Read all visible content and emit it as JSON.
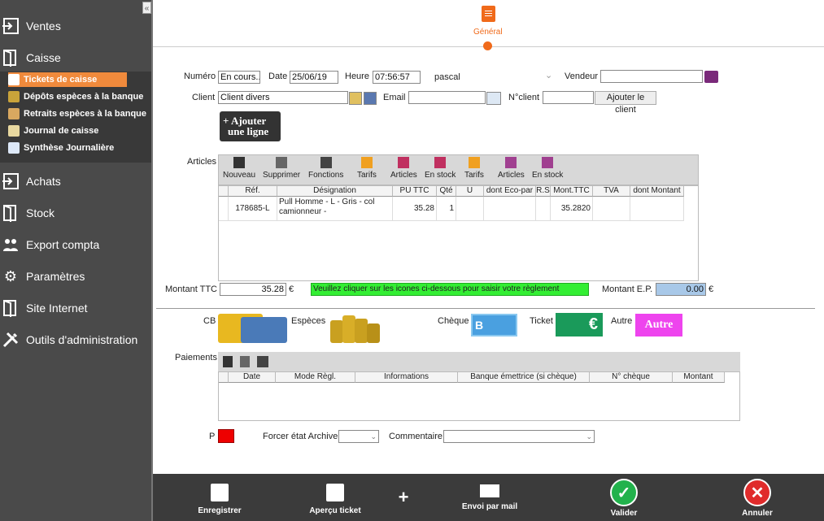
{
  "sidebar": {
    "collapse": "«",
    "items": [
      {
        "label": "Ventes",
        "icon": "enter-icon"
      },
      {
        "label": "Caisse",
        "icon": "door-icon"
      },
      {
        "label": "Achats",
        "icon": "enter-icon"
      },
      {
        "label": "Stock",
        "icon": "door-icon"
      },
      {
        "label": "Export compta",
        "icon": "people-icon"
      },
      {
        "label": "Paramètres",
        "icon": "gear-icon"
      },
      {
        "label": "Site Internet",
        "icon": "door-icon"
      },
      {
        "label": "Outils d'administration",
        "icon": "tools-icon"
      }
    ],
    "sub_items": [
      {
        "label": "Tickets de caisse"
      },
      {
        "label": "Dépôts espèces à la banque"
      },
      {
        "label": "Retraits espèces à la banque"
      },
      {
        "label": "Journal de caisse"
      },
      {
        "label": "Synthèse Journalière"
      }
    ]
  },
  "tab": {
    "label": "Général"
  },
  "form": {
    "numero_label": "Numéro",
    "numero": "En cours...",
    "date_label": "Date",
    "date": "25/06/19",
    "heure_label": "Heure",
    "heure": "07:56:57",
    "user": "pascal",
    "vendeur_label": "Vendeur",
    "vendeur": "",
    "client_label": "Client",
    "client": "Client divers",
    "email_label": "Email",
    "email": "",
    "nclient_label": "N°client",
    "nclient": "",
    "add_client": "Ajouter le client",
    "add_line_1": "+ Ajouter",
    "add_line_2": "une ligne"
  },
  "articles": {
    "label": "Articles",
    "toolbar": [
      "Nouveau",
      "Supprimer",
      "Fonctions",
      "Tarifs",
      "Articles",
      "En stock",
      "Tarifs",
      "Articles",
      "En stock"
    ],
    "columns": [
      "Réf.",
      "Désignation",
      "PU TTC",
      "Qté",
      "U",
      "dont Eco-par",
      "R.S",
      "Mont.TTC",
      "TVA",
      "dont Montant"
    ],
    "rows": [
      {
        "ref": "178685-L",
        "designation": "Pull Homme - L - Gris - col camionneur -",
        "pu": "35.28",
        "qte": "1",
        "u": "",
        "eco": "",
        "rs": "",
        "mont": "35.2820",
        "tva": "",
        "dont": ""
      }
    ]
  },
  "totals": {
    "montant_ttc_label": "Montant TTC",
    "montant_ttc": "35.28",
    "currency": "€",
    "message": "Veuillez cliquer sur les icones ci-dessous pour saisir votre règlement",
    "montant_ep_label": "Montant E.P.",
    "montant_ep": "0.00"
  },
  "payment_modes": {
    "cb": "CB",
    "especes": "Espèces",
    "cheque": "Chèque",
    "ticket": "Ticket",
    "autre": "Autre",
    "autre_btn": "Autre",
    "euro": "€"
  },
  "paiements": {
    "label": "Paiements",
    "columns": [
      "Date",
      "Mode Règl.",
      "Informations",
      "Banque émettrice (si chèque)",
      "N° chèque",
      "Montant"
    ]
  },
  "bottom": {
    "p_label": "P",
    "forcer_label": "Forcer état Archive",
    "commentaire_label": "Commentaire"
  },
  "footer": {
    "enregistrer": "Enregistrer",
    "apercu": "Aperçu ticket",
    "plus": "+",
    "mail": "Envoi par mail",
    "valider": "Valider",
    "annuler": "Annuler"
  },
  "colors": {
    "accent": "#f06a1a",
    "message_bg": "#33ee33",
    "ep_bg": "#a8c8e8",
    "p_red": "#ee0000"
  }
}
